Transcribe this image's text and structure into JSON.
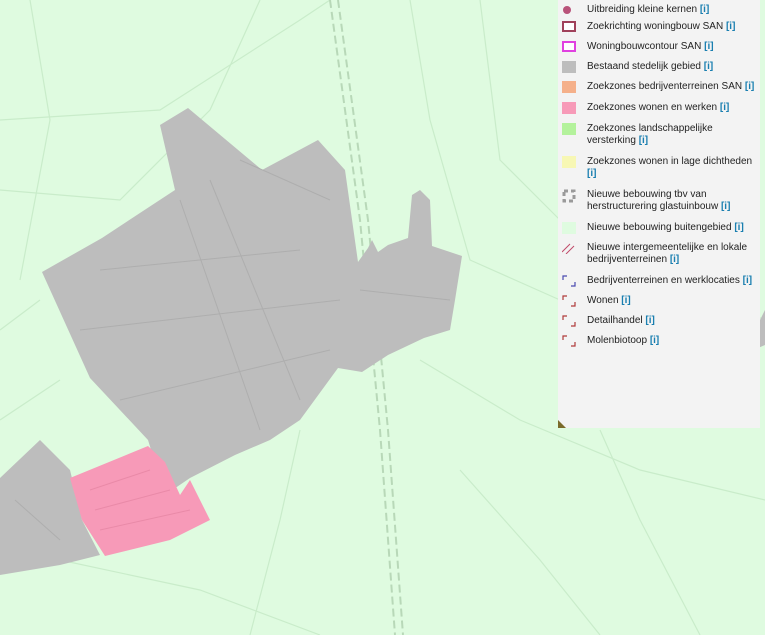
{
  "legend": {
    "info_label": "[i]",
    "items": [
      {
        "label": "Uitbreiding kleine kernen",
        "symbol": "dot",
        "color": "#b9527a"
      },
      {
        "label": "Zoekrichting woningbouw SAN",
        "symbol": "outline-box",
        "color": "#a0405a"
      },
      {
        "label": "Woningbouwcontour SAN",
        "symbol": "outline-box",
        "color": "#e040e0"
      },
      {
        "label": "Bestaand stedelijk gebied",
        "symbol": "fill",
        "color": "#bdbdbd"
      },
      {
        "label": "Zoekzones bedrijventerreinen SAN",
        "symbol": "fill",
        "color": "#f5b08a"
      },
      {
        "label": "Zoekzones wonen en werken",
        "symbol": "fill",
        "color": "#f79ab8"
      },
      {
        "label": "Zoekzones landschappelijke versterking",
        "symbol": "fill",
        "color": "#b4f29c"
      },
      {
        "label": "Zoekzones wonen in lage dichtheden",
        "symbol": "fill",
        "color": "#f7f7b4"
      },
      {
        "label": "Nieuwe bebouwing tbv van herstructurering glastuinbouw",
        "symbol": "dashed-gray",
        "color": "#9a9a9a"
      },
      {
        "label": "Nieuwe bebouwing buitengebied",
        "symbol": "fill",
        "color": "#dffbe0"
      },
      {
        "label": "Nieuwe intergemeentelijke en lokale bedrijventerreinen",
        "symbol": "hatch",
        "color": "#c04a6a"
      },
      {
        "label": "Bedrijventerreinen en werklocaties",
        "symbol": "corner",
        "color": "#4a4ab0"
      },
      {
        "label": "Wonen",
        "symbol": "corner",
        "color": "#b03a3a"
      },
      {
        "label": "Detailhandel",
        "symbol": "corner",
        "color": "#b03a3a"
      },
      {
        "label": "Molenbiotoop",
        "symbol": "corner",
        "color": "#b03a3a"
      }
    ]
  },
  "map_colors": {
    "background": "#dffbe0",
    "urban": "#bdbdbd",
    "pink_zone": "#f79ab8",
    "roads": "#c9ecca",
    "railway": "#b8d8b8"
  }
}
